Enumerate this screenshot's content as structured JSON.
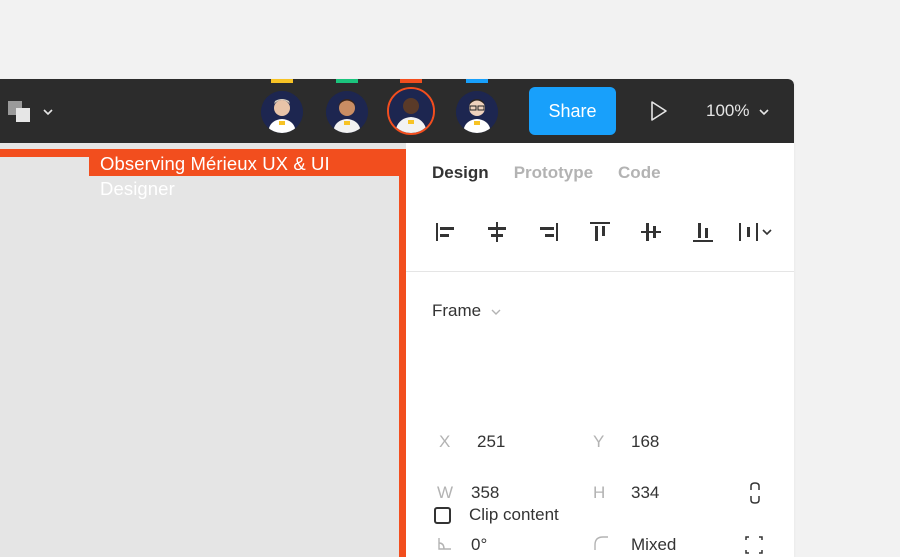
{
  "toolbar": {
    "share_label": "Share",
    "zoom_label": "100%",
    "icons": {
      "shapes": "layers-shapes-icon",
      "play": "play-icon",
      "dropdown": "chevron-down-icon"
    }
  },
  "collaborators": [
    {
      "color": "#f7c325",
      "active": false
    },
    {
      "color": "#1bc47d",
      "active": false
    },
    {
      "color": "#f24e1e",
      "active": true
    },
    {
      "color": "#18a0fb",
      "active": false
    }
  ],
  "canvas": {
    "frame_name": "Observing Mérieux UX & UI Designer",
    "frame_color": "#f24e1e"
  },
  "panel": {
    "tabs": [
      "Design",
      "Prototype",
      "Code"
    ],
    "active_tab": "Design",
    "frame_type": "Frame",
    "x_label": "X",
    "x_value": "251",
    "y_label": "Y",
    "y_value": "168",
    "w_label": "W",
    "w_value": "358",
    "h_label": "H",
    "h_value": "334",
    "rotation_value": "0°",
    "radius_value": "Mixed",
    "clip_label": "Clip content",
    "clip_checked": false
  },
  "colors": {
    "accent": "#18a0fb",
    "selection": "#f24e1e",
    "toolbar_bg": "#2c2c2c"
  }
}
